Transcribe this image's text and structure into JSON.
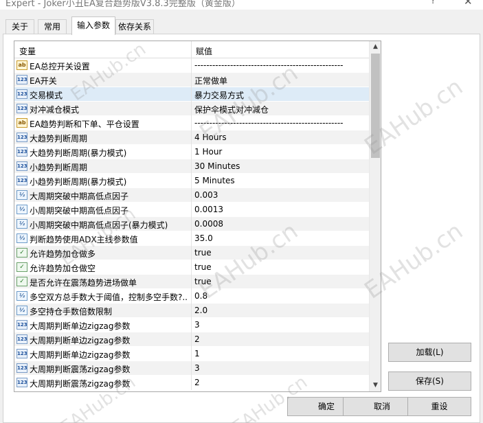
{
  "window": {
    "title": "Expert - Joker小丑EA复合趋势版V3.8.3完整版（黄金版）",
    "help_glyph": "?",
    "close_glyph": "✕"
  },
  "tabs": [
    {
      "label": "关于",
      "active": false
    },
    {
      "label": "常用",
      "active": false
    },
    {
      "label": "输入参数",
      "active": true
    },
    {
      "label": "依存关系",
      "active": false
    }
  ],
  "grid": {
    "col_variable": "变量",
    "col_value": "赋值",
    "rows": [
      {
        "icon": "ab",
        "name": "EA总控开关设置",
        "value": "--------------------------------------------------"
      },
      {
        "icon": "123",
        "name": "EA开关",
        "value": "正常做单"
      },
      {
        "icon": "123",
        "name": "交易模式",
        "value": "暴力交易方式"
      },
      {
        "icon": "123",
        "name": "对冲减仓模式",
        "value": "保护伞模式对冲减仓"
      },
      {
        "icon": "ab",
        "name": "EA趋势判断和下单、平仓设置",
        "value": "--------------------------------------------------"
      },
      {
        "icon": "123",
        "name": "大趋势判断周期",
        "value": "4 Hours"
      },
      {
        "icon": "123",
        "name": "大趋势判断周期(暴力模式)",
        "value": "1 Hour"
      },
      {
        "icon": "123",
        "name": "小趋势判断周期",
        "value": "30 Minutes"
      },
      {
        "icon": "123",
        "name": "小趋势判断周期(暴力模式)",
        "value": "5 Minutes"
      },
      {
        "icon": "va",
        "name": "大周期突破中期高低点因子",
        "value": "0.003"
      },
      {
        "icon": "va",
        "name": "小周期突破中期高低点因子",
        "value": "0.0013"
      },
      {
        "icon": "va",
        "name": "小周期突破中期高低点因子(暴力模式)",
        "value": "0.0008"
      },
      {
        "icon": "va",
        "name": "判断趋势使用ADX主线参数值",
        "value": "35.0"
      },
      {
        "icon": "bool",
        "name": "允许趋势加仓做多",
        "value": "true"
      },
      {
        "icon": "bool",
        "name": "允许趋势加仓做空",
        "value": "true"
      },
      {
        "icon": "bool",
        "name": "是否允许在震荡趋势进场做单",
        "value": "true"
      },
      {
        "icon": "va",
        "name": "多空双方总手数大于阈值，控制多空手数?..",
        "value": "0.8"
      },
      {
        "icon": "va",
        "name": "多空持仓手数倍数限制",
        "value": "2.0"
      },
      {
        "icon": "123",
        "name": "大周期判断单边zigzag参数",
        "value": "3"
      },
      {
        "icon": "123",
        "name": "大周期判断单边zigzag参数",
        "value": "2"
      },
      {
        "icon": "123",
        "name": "大周期判断单边zigzag参数",
        "value": "1"
      },
      {
        "icon": "123",
        "name": "大周期判断震荡zigzag参数",
        "value": "3"
      },
      {
        "icon": "123",
        "name": "大周期判断震荡zigzag参数",
        "value": "2"
      }
    ]
  },
  "buttons": {
    "load": "加载(L)",
    "save": "保存(S)",
    "ok": "确定",
    "cancel": "取消",
    "reset": "重设"
  },
  "watermark": "EAHub.cn",
  "scroll_position": 0.0
}
